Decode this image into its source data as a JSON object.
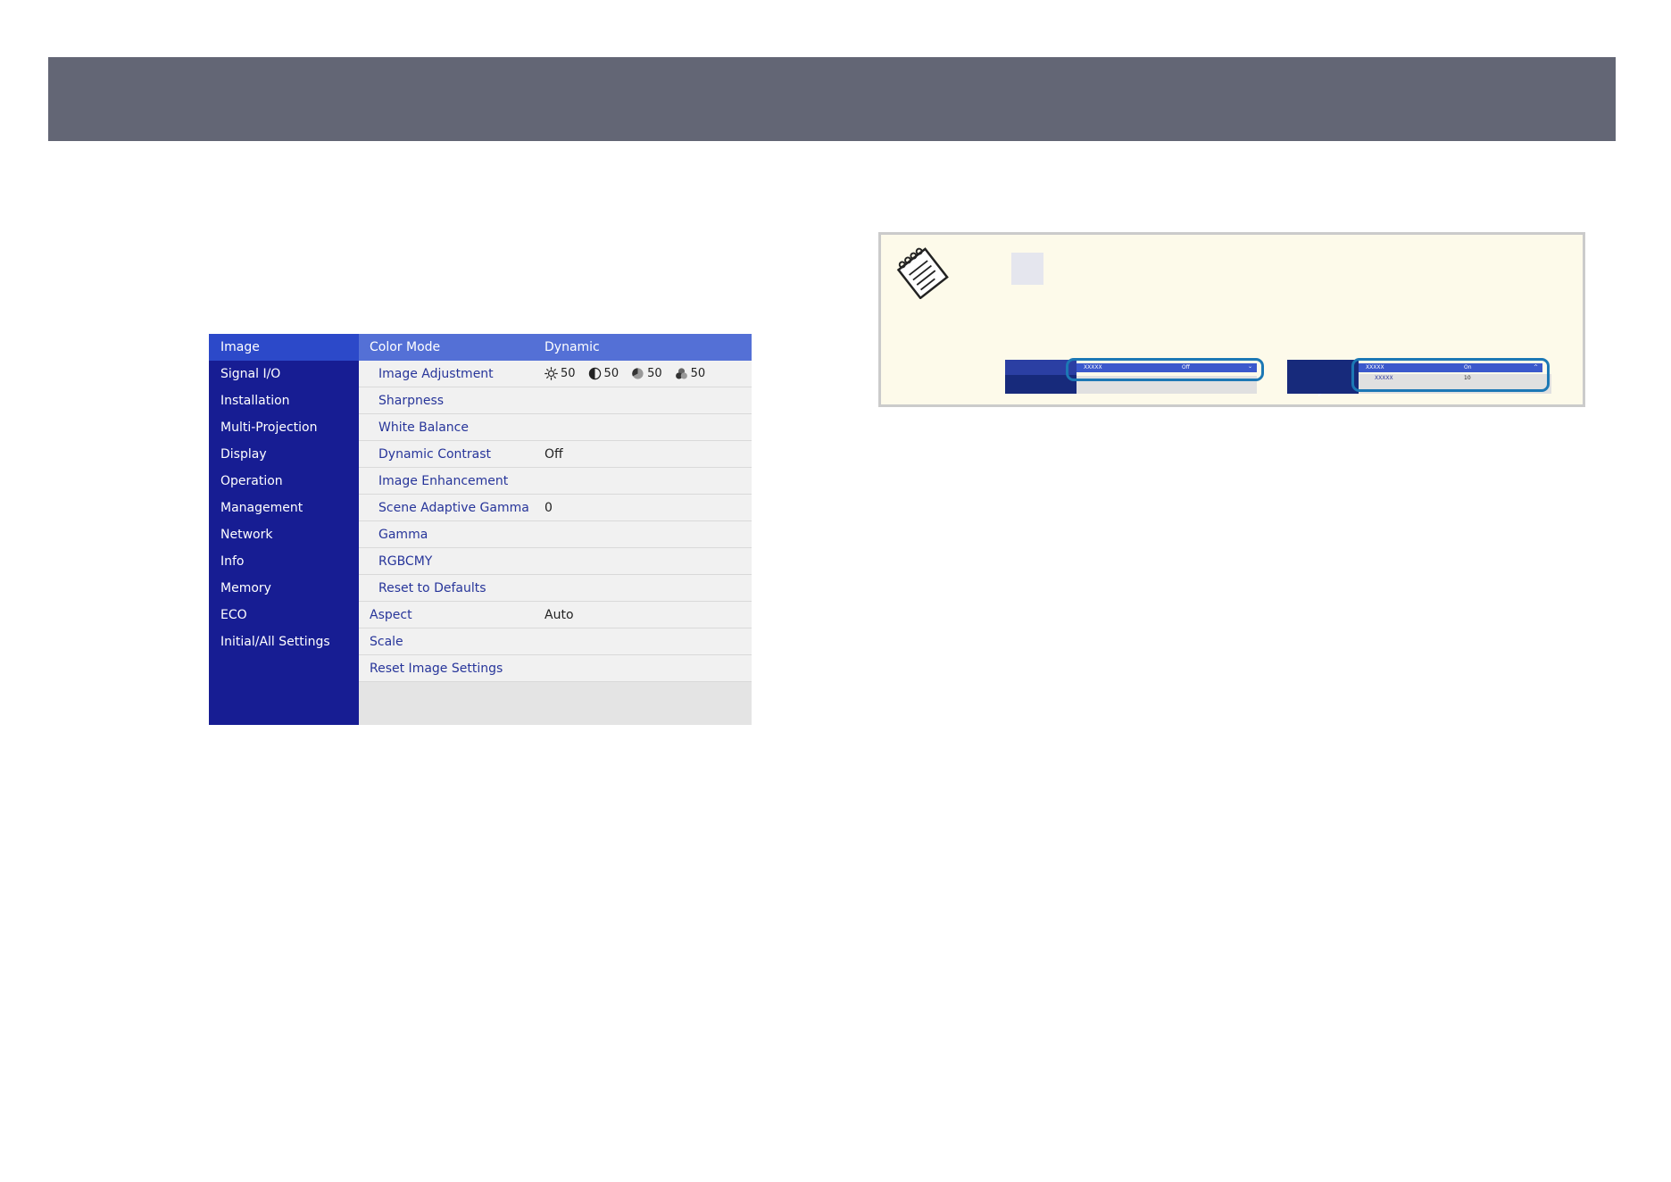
{
  "menu": {
    "sidebar": [
      "Image",
      "Signal I/O",
      "Installation",
      "Multi-Projection",
      "Display",
      "Operation",
      "Management",
      "Network",
      "Info",
      "Memory",
      "ECO",
      "Initial/All Settings"
    ],
    "rows": [
      {
        "label": "Color Mode",
        "value": "Dynamic"
      },
      {
        "label": "Image Adjustment",
        "value": ""
      },
      {
        "label": "Sharpness",
        "value": ""
      },
      {
        "label": "White Balance",
        "value": ""
      },
      {
        "label": "Dynamic Contrast",
        "value": "Off"
      },
      {
        "label": "Image Enhancement",
        "value": ""
      },
      {
        "label": "Scene Adaptive Gamma",
        "value": "0"
      },
      {
        "label": "Gamma",
        "value": ""
      },
      {
        "label": "RGBCMY",
        "value": ""
      },
      {
        "label": "Reset to Defaults",
        "value": ""
      },
      {
        "label": "Aspect",
        "value": "Auto"
      },
      {
        "label": "Scale",
        "value": ""
      },
      {
        "label": "Reset Image Settings",
        "value": ""
      }
    ],
    "image_adjustment": {
      "brightness": "50",
      "contrast": "50",
      "saturation": "50",
      "tint": "50",
      "icons": [
        "brightness-icon",
        "contrast-icon",
        "saturation-icon",
        "tint-icon"
      ]
    }
  },
  "note": {
    "icon": "note-icon",
    "before": {
      "item": "XXXXX",
      "value": "Off"
    },
    "after": {
      "item": "XXXXX",
      "value": "On",
      "sub_item": "XXXXX",
      "sub_value": "10"
    }
  },
  "colors": {
    "header": "#636675",
    "sidebar": "#171d93",
    "selected": "#5470d6",
    "note_bg": "#fdfaea",
    "highlight": "#1c78b5"
  }
}
